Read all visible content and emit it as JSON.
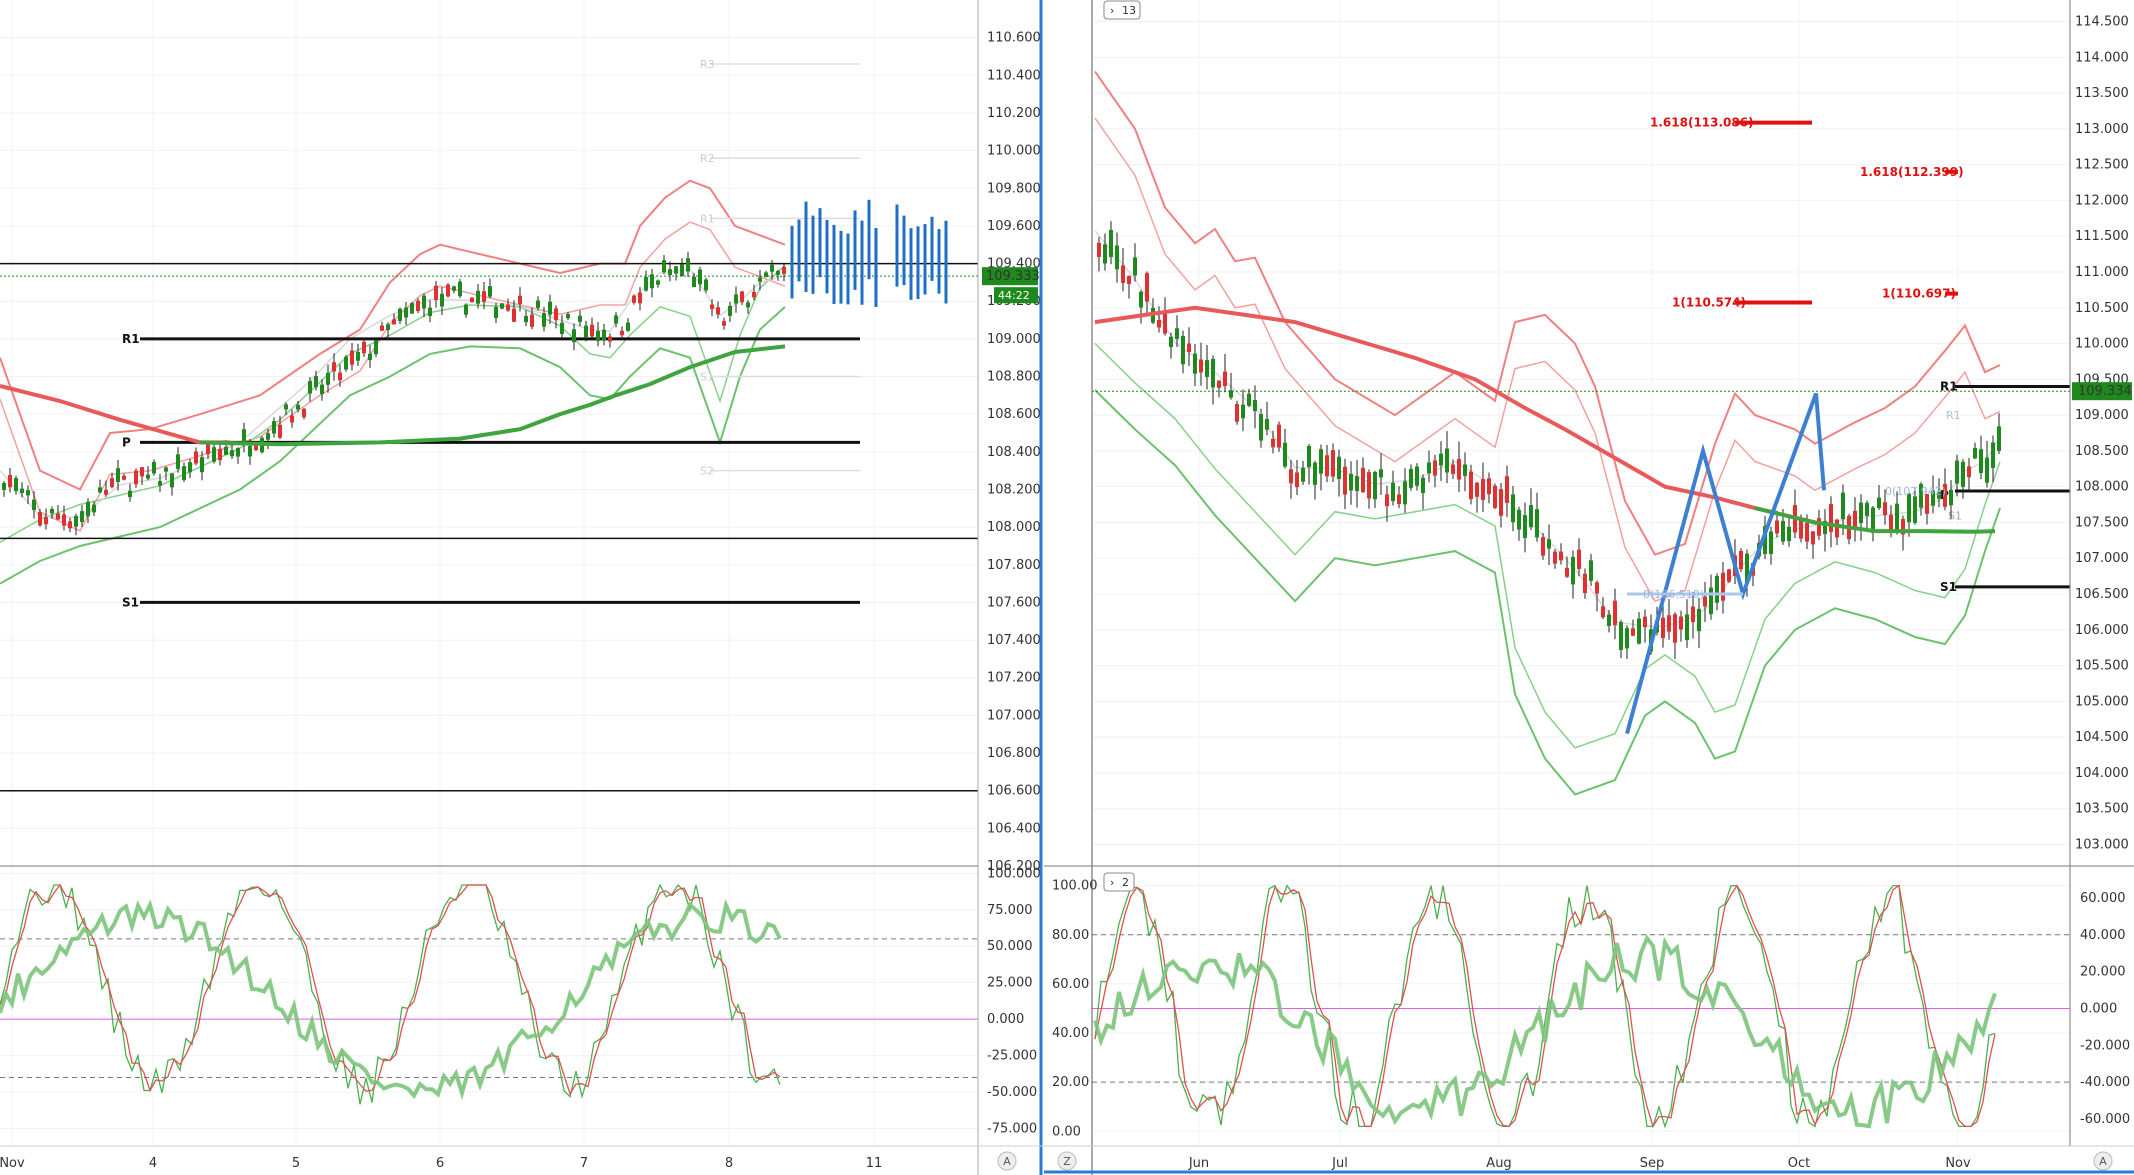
{
  "chart_data": [
    {
      "type": "line",
      "panel": "left-price",
      "price_axis": [
        "110.600",
        "110.400",
        "110.200",
        "110.000",
        "109.800",
        "109.600",
        "109.400",
        "109.200",
        "109.000",
        "108.800",
        "108.600",
        "108.400",
        "108.200",
        "108.000",
        "107.800",
        "107.600",
        "107.400",
        "107.200",
        "107.000",
        "106.800",
        "106.600",
        "106.400",
        "106.200"
      ],
      "time_axis": [
        "Nov",
        "4",
        "5",
        "6",
        "7",
        "8",
        "11"
      ],
      "ylim": [
        106.2,
        110.8
      ],
      "last_price": "109.333",
      "countdown": "44:22",
      "pivots": [
        {
          "label": "R3",
          "value": 110.46,
          "faint": true
        },
        {
          "label": "R2",
          "value": 109.96,
          "faint": true
        },
        {
          "label": "R1",
          "value": 109.64,
          "faint": true
        },
        {
          "label": "R1",
          "value": 109.0,
          "faint": false
        },
        {
          "label": "P",
          "value": 108.45,
          "faint": false
        },
        {
          "label": "S1",
          "value": 108.8,
          "faint": true
        },
        {
          "label": "S2",
          "value": 108.3,
          "faint": true
        },
        {
          "label": "S1",
          "value": 107.6,
          "faint": false
        }
      ],
      "hlines": [
        109.4,
        107.94,
        106.6
      ],
      "ma_red": [
        [
          0,
          108.75
        ],
        [
          60,
          108.67
        ],
        [
          120,
          108.57
        ],
        [
          200,
          108.45
        ],
        [
          280,
          108.44
        ],
        [
          380,
          108.45
        ],
        [
          460,
          108.47
        ],
        [
          520,
          108.52
        ],
        [
          560,
          108.6
        ],
        [
          590,
          108.65
        ],
        [
          616,
          108.7
        ],
        [
          650,
          108.76
        ],
        [
          690,
          108.85
        ],
        [
          735,
          108.93
        ],
        [
          785,
          108.96
        ]
      ],
      "bb_upper": [
        [
          0,
          108.9
        ],
        [
          40,
          108.3
        ],
        [
          80,
          108.2
        ],
        [
          110,
          108.5
        ],
        [
          150,
          108.52
        ],
        [
          200,
          108.6
        ],
        [
          260,
          108.7
        ],
        [
          320,
          108.92
        ],
        [
          360,
          109.05
        ],
        [
          390,
          109.3
        ],
        [
          420,
          109.45
        ],
        [
          440,
          109.5
        ],
        [
          480,
          109.45
        ],
        [
          520,
          109.4
        ],
        [
          560,
          109.35
        ],
        [
          600,
          109.4
        ],
        [
          625,
          109.4
        ],
        [
          640,
          109.6
        ],
        [
          665,
          109.75
        ],
        [
          690,
          109.84
        ],
        [
          710,
          109.8
        ],
        [
          735,
          109.6
        ],
        [
          760,
          109.55
        ],
        [
          785,
          109.5
        ]
      ],
      "bb_lower": [
        [
          0,
          107.7
        ],
        [
          40,
          107.82
        ],
        [
          80,
          107.9
        ],
        [
          120,
          107.95
        ],
        [
          160,
          108.0
        ],
        [
          200,
          108.1
        ],
        [
          240,
          108.2
        ],
        [
          280,
          108.35
        ],
        [
          310,
          108.5
        ],
        [
          350,
          108.7
        ],
        [
          390,
          108.8
        ],
        [
          430,
          108.92
        ],
        [
          470,
          108.96
        ],
        [
          520,
          108.95
        ],
        [
          560,
          108.85
        ],
        [
          590,
          108.7
        ],
        [
          610,
          108.68
        ],
        [
          630,
          108.8
        ],
        [
          660,
          108.95
        ],
        [
          690,
          108.9
        ],
        [
          720,
          108.45
        ],
        [
          740,
          108.8
        ],
        [
          760,
          109.05
        ],
        [
          785,
          109.17
        ]
      ]
    },
    {
      "type": "line",
      "panel": "left-oscillator",
      "osc_axis": [
        "100.000",
        "75.000",
        "50.000",
        "25.000",
        "0.000",
        "-25.000",
        "-50.000",
        "-75.000"
      ],
      "ylim": [
        -87,
        105
      ],
      "levels": [
        55,
        -40,
        0
      ]
    },
    {
      "type": "line",
      "panel": "right-price",
      "price_axis": [
        "114.500",
        "114.000",
        "113.500",
        "113.000",
        "112.500",
        "112.000",
        "111.500",
        "111.000",
        "110.500",
        "110.000",
        "109.500",
        "109.000",
        "108.500",
        "108.000",
        "107.500",
        "107.000",
        "106.500",
        "106.000",
        "105.500",
        "105.000",
        "104.500",
        "104.000",
        "103.500",
        "103.000"
      ],
      "time_axis": [
        "Jun",
        "Jul",
        "Aug",
        "Sep",
        "Oct",
        "Nov"
      ],
      "ylim": [
        102.7,
        114.8
      ],
      "last_price": "109.334",
      "study_badge": "13",
      "fib_labels": [
        {
          "label": "1.618(113.086)",
          "value": 113.086
        },
        {
          "label": "1.618(112.399)",
          "value": 112.399
        },
        {
          "label": "1(110.574)",
          "value": 110.574
        },
        {
          "label": "1(110.697)",
          "value": 110.697
        }
      ],
      "abc_labels": [
        "0(106.510)",
        "0(107.942)"
      ],
      "pivot_labels": [
        "R1",
        "R1",
        "P",
        "S1",
        "S1"
      ],
      "pivot_lines": [
        109.4,
        107.94,
        106.6
      ],
      "ma_red": [
        [
          0,
          110.3
        ],
        [
          50,
          110.4
        ],
        [
          100,
          110.5
        ],
        [
          150,
          110.4
        ],
        [
          200,
          110.3
        ],
        [
          260,
          110.05
        ],
        [
          320,
          109.8
        ],
        [
          380,
          109.5
        ],
        [
          430,
          109.1
        ],
        [
          470,
          108.8
        ],
        [
          520,
          108.4
        ],
        [
          570,
          108.0
        ],
        [
          620,
          107.85
        ],
        [
          660,
          107.7
        ],
        [
          720,
          107.5
        ],
        [
          780,
          107.38
        ],
        [
          830,
          107.38
        ],
        [
          880,
          107.37
        ],
        [
          900,
          107.38
        ]
      ],
      "bb_upper": [
        [
          0,
          113.8
        ],
        [
          40,
          113.0
        ],
        [
          70,
          111.9
        ],
        [
          100,
          111.4
        ],
        [
          120,
          111.6
        ],
        [
          140,
          111.15
        ],
        [
          160,
          111.2
        ],
        [
          190,
          110.3
        ],
        [
          240,
          109.5
        ],
        [
          300,
          109.0
        ],
        [
          360,
          109.6
        ],
        [
          400,
          109.2
        ],
        [
          420,
          110.3
        ],
        [
          450,
          110.4
        ],
        [
          480,
          110.0
        ],
        [
          500,
          109.4
        ],
        [
          530,
          107.8
        ],
        [
          560,
          107.05
        ],
        [
          590,
          107.2
        ],
        [
          620,
          108.6
        ],
        [
          640,
          109.3
        ],
        [
          660,
          109.0
        ],
        [
          700,
          108.8
        ],
        [
          720,
          108.6
        ],
        [
          760,
          108.9
        ],
        [
          790,
          109.1
        ],
        [
          820,
          109.4
        ],
        [
          850,
          109.9
        ],
        [
          870,
          110.25
        ],
        [
          890,
          109.6
        ],
        [
          905,
          109.7
        ]
      ],
      "bb_lower": [
        [
          0,
          109.35
        ],
        [
          40,
          108.8
        ],
        [
          80,
          108.3
        ],
        [
          120,
          107.6
        ],
        [
          160,
          107.0
        ],
        [
          200,
          106.4
        ],
        [
          240,
          107.0
        ],
        [
          280,
          106.9
        ],
        [
          320,
          107.0
        ],
        [
          360,
          107.1
        ],
        [
          400,
          106.8
        ],
        [
          420,
          105.1
        ],
        [
          450,
          104.2
        ],
        [
          480,
          103.7
        ],
        [
          520,
          103.9
        ],
        [
          550,
          104.8
        ],
        [
          570,
          105.0
        ],
        [
          600,
          104.7
        ],
        [
          620,
          104.2
        ],
        [
          640,
          104.3
        ],
        [
          670,
          105.5
        ],
        [
          700,
          106.0
        ],
        [
          740,
          106.3
        ],
        [
          780,
          106.15
        ],
        [
          820,
          105.9
        ],
        [
          850,
          105.8
        ],
        [
          870,
          106.2
        ],
        [
          890,
          107.1
        ],
        [
          905,
          107.7
        ]
      ],
      "pattern": [
        [
          532,
          104.55
        ],
        [
          608,
          108.5
        ],
        [
          648,
          106.5
        ],
        [
          721,
          109.3
        ],
        [
          729,
          107.95
        ]
      ]
    },
    {
      "type": "line",
      "panel": "right-oscillator",
      "study_badge": "2",
      "osc_axis_left": [
        "100.00",
        "80.00",
        "60.00",
        "40.00",
        "20.00",
        "0.00"
      ],
      "osc_axis_right": [
        "60.000",
        "40.000",
        "20.000",
        "0.000",
        "-20.000",
        "-40.000",
        "-60.000"
      ],
      "ylim": [
        -6,
        108
      ],
      "levels": [
        80,
        20,
        50
      ]
    }
  ],
  "buttons": {
    "a_left": "A",
    "z": "Z",
    "a_right": "A"
  }
}
